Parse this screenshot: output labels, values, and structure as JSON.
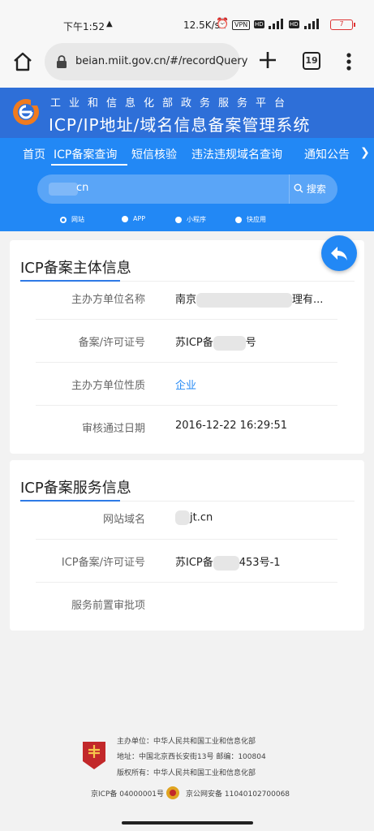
{
  "status": {
    "time": "下午1:52",
    "net_rate": "12.5K/s",
    "vpn": "VPN",
    "hd1": "HD",
    "hd2": "HD",
    "battery": "7"
  },
  "browser": {
    "url": "beian.miit.gov.cn/#/recordQuery",
    "tab_count": "19"
  },
  "header": {
    "subtitle": "工业和信息化部政务服务平台",
    "title": "ICP/IP地址/域名信息备案管理系统"
  },
  "nav": {
    "items": [
      "首页",
      "ICP备案查询",
      "短信核验",
      "违法违规域名查询",
      "通知公告"
    ],
    "arrow": "❯"
  },
  "search": {
    "value": "cn",
    "button": "搜索"
  },
  "radios": {
    "items": [
      "网站",
      "APP",
      "小程序",
      "快应用"
    ],
    "selected": "网站"
  },
  "card1": {
    "title": "ICP备案主体信息",
    "rows": [
      {
        "label": "主办方单位名称",
        "value_prefix": "南京",
        "value_suffix": "理有..."
      },
      {
        "label": "备案/许可证号",
        "value_prefix": "苏ICP备",
        "value_suffix": "号"
      },
      {
        "label": "主办方单位性质",
        "value": "企业"
      },
      {
        "label": "审核通过日期",
        "value": "2016-12-22 16:29:51"
      }
    ]
  },
  "card2": {
    "title": "ICP备案服务信息",
    "rows": [
      {
        "label": "网站域名",
        "value_suffix": "jt.cn"
      },
      {
        "label": "ICP备案/许可证号",
        "value_prefix": "苏ICP备",
        "value_suffix": "453号-1"
      },
      {
        "label": "服务前置审批项",
        "value": ""
      }
    ]
  },
  "footer": {
    "line1": "主办单位：中华人民共和国工业和信息化部",
    "line2": "地址：中国北京西长安街13号 邮编：100804",
    "line3": "版权所有：中华人民共和国工业和信息化部",
    "icp": "京ICP备 04000001号",
    "police": "京公网安备 11040102700068",
    "emblem_text": "党政机关"
  },
  "colors": {
    "header_bg": "#2e6fd8",
    "nav_bg": "#2288f5",
    "accent": "#2288f5"
  }
}
